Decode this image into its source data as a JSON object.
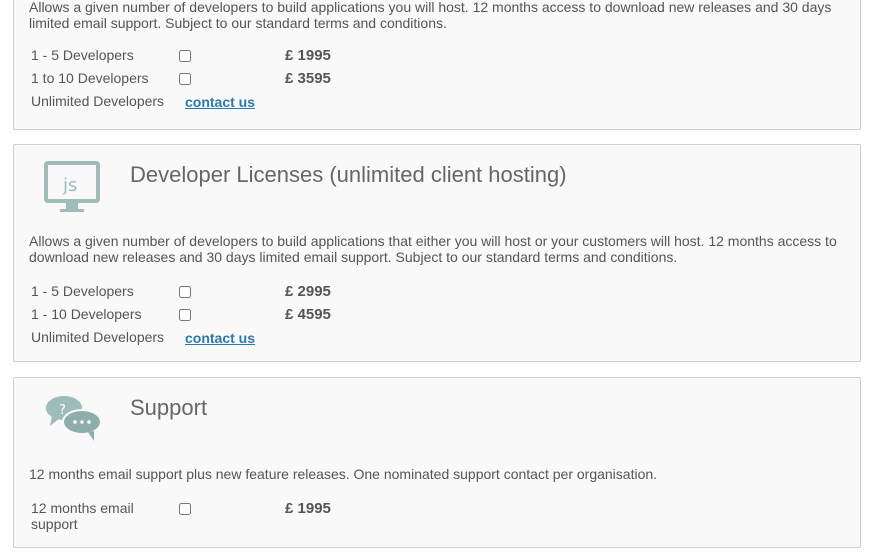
{
  "colors": {
    "panel_bg": "#f9f9f9",
    "border": "#cfcfcf",
    "link": "#2a7ab0",
    "icon": "#9fbcb8"
  },
  "hosted": {
    "description": "Allows a given number of developers to build applications you will host. 12 months access to download new releases and 30 days limited email support. Subject to our standard terms and conditions.",
    "options": [
      {
        "label": "1 - 5 Developers",
        "price": "£ 1995"
      },
      {
        "label": "1 to 10 Developers",
        "price": "£ 3595"
      }
    ],
    "unlimited": {
      "label": "Unlimited Developers",
      "link": "contact us"
    }
  },
  "developer": {
    "icon": "monitor-js-icon",
    "title": "Developer Licenses (unlimited client hosting)",
    "description": "Allows a given number of developers to build applications that either you will host or your customers will host. 12 months access to download new releases and 30 days limited email support. Subject to our standard terms and conditions.",
    "options": [
      {
        "label": "1 - 5 Developers",
        "price": "£ 2995"
      },
      {
        "label": "1 - 10 Developers",
        "price": "£ 4595"
      }
    ],
    "unlimited": {
      "label": "Unlimited Developers",
      "link": "contact us"
    }
  },
  "support": {
    "icon": "speech-bubbles-icon",
    "title": "Support",
    "description": "12 months email support plus new feature releases. One nominated support contact per organisation.",
    "options": [
      {
        "label": "12 months email support",
        "price": "£ 1995"
      }
    ]
  }
}
